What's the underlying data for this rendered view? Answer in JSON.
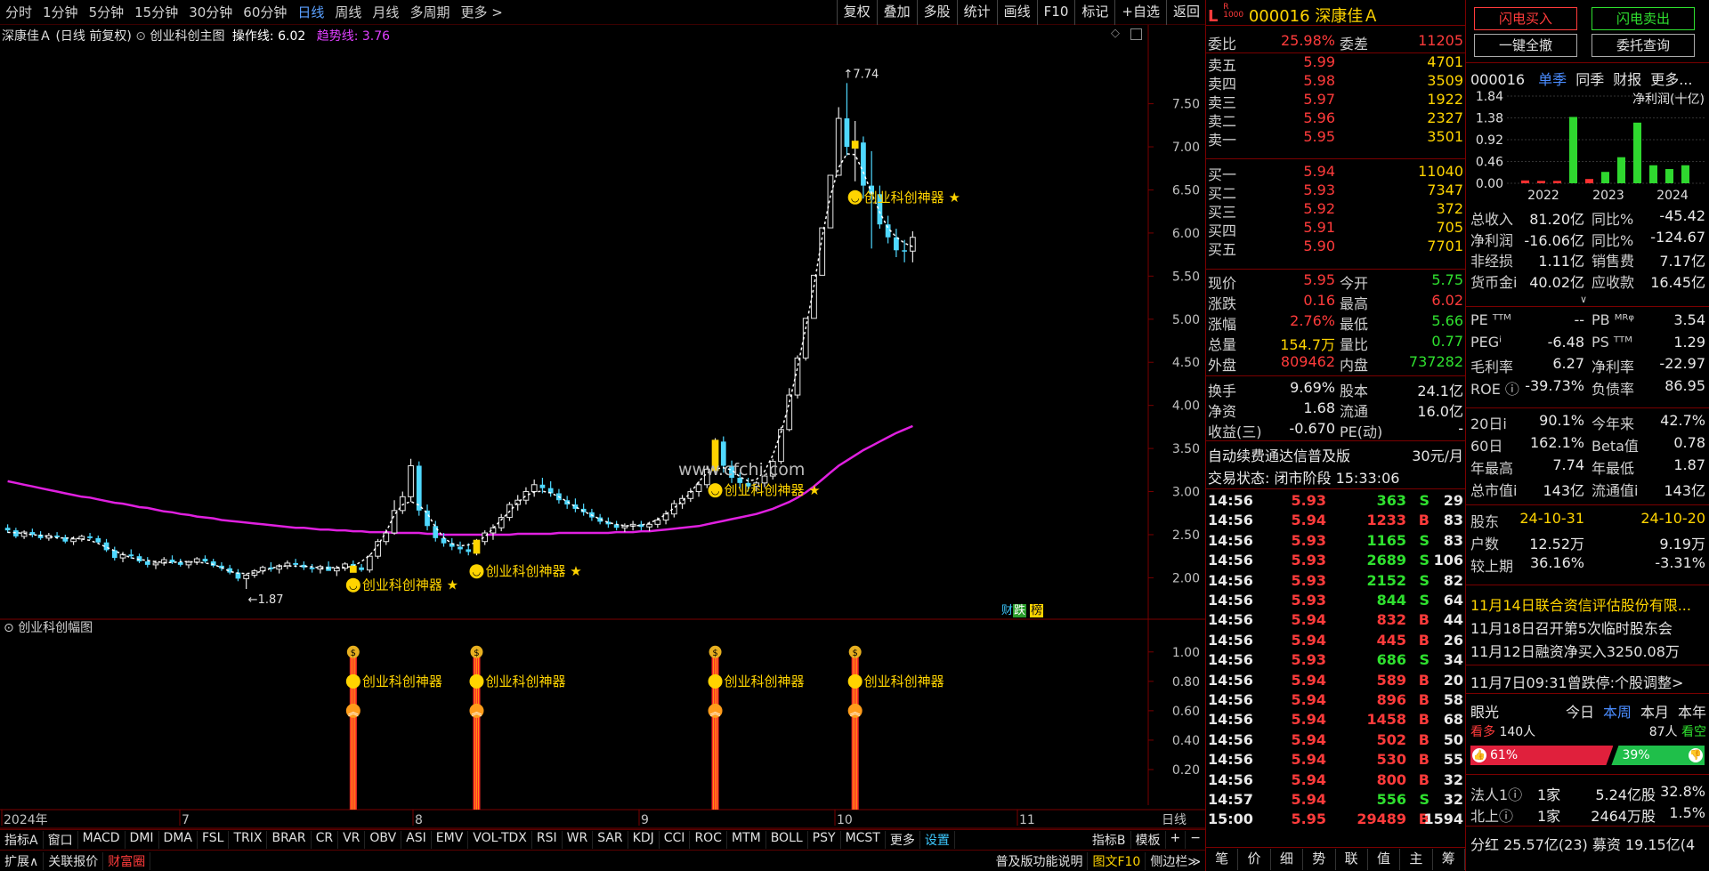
{
  "toolbar": {
    "periods": [
      "分时",
      "1分钟",
      "5分钟",
      "15分钟",
      "30分钟",
      "60分钟",
      "日线",
      "周线",
      "月线",
      "多周期",
      "更多 >"
    ],
    "active_period": "日线",
    "right_buttons": [
      "复权",
      "叠加",
      "多股",
      "统计",
      "画线",
      "F10",
      "标记",
      "+自选",
      "返回"
    ]
  },
  "chart_header": {
    "stock": "深康佳Ａ",
    "mode": "(日线 前复权)",
    "indicator": "创业科创主图",
    "op_line_label": "操作线:",
    "op_line_value": "6.02",
    "trend_line_label": "趋势线:",
    "trend_line_value": "3.76"
  },
  "sub_chart_title": "创业科创幅图",
  "signal_label": "创业科创神器",
  "watermark": "www.cfchi.com",
  "marks": {
    "high": "7.74",
    "low": "1.87"
  },
  "badge": {
    "a": "财",
    "b": "跌",
    "c": "榜"
  },
  "x_axis_labels": [
    "2024年",
    "7",
    "8",
    "9",
    "10",
    "11"
  ],
  "x_axis_right": "日线",
  "chart_data": {
    "type": "candlestick",
    "y_ticks": [
      2.0,
      2.5,
      3.0,
      3.5,
      4.0,
      4.5,
      5.0,
      5.5,
      6.0,
      6.5,
      7.0,
      7.5
    ],
    "ylim": [
      1.55,
      7.95
    ],
    "sub_y_ticks": [
      0.2,
      0.4,
      0.6,
      0.8,
      1.0
    ],
    "sub_ylim": [
      0,
      1.15
    ],
    "ohlc": [
      [
        2.58,
        2.62,
        2.52,
        2.55
      ],
      [
        2.55,
        2.58,
        2.46,
        2.48
      ],
      [
        2.48,
        2.55,
        2.45,
        2.53
      ],
      [
        2.53,
        2.57,
        2.47,
        2.5
      ],
      [
        2.5,
        2.54,
        2.44,
        2.46
      ],
      [
        2.46,
        2.52,
        2.43,
        2.49
      ],
      [
        2.49,
        2.53,
        2.45,
        2.47
      ],
      [
        2.47,
        2.5,
        2.4,
        2.42
      ],
      [
        2.42,
        2.48,
        2.38,
        2.45
      ],
      [
        2.45,
        2.5,
        2.42,
        2.48
      ],
      [
        2.48,
        2.52,
        2.44,
        2.46
      ],
      [
        2.46,
        2.49,
        2.4,
        2.41
      ],
      [
        2.41,
        2.45,
        2.3,
        2.32
      ],
      [
        2.32,
        2.36,
        2.2,
        2.23
      ],
      [
        2.23,
        2.3,
        2.18,
        2.27
      ],
      [
        2.27,
        2.33,
        2.22,
        2.25
      ],
      [
        2.25,
        2.28,
        2.17,
        2.19
      ],
      [
        2.19,
        2.24,
        2.12,
        2.15
      ],
      [
        2.15,
        2.2,
        2.1,
        2.17
      ],
      [
        2.17,
        2.24,
        2.14,
        2.21
      ],
      [
        2.21,
        2.26,
        2.16,
        2.18
      ],
      [
        2.18,
        2.22,
        2.13,
        2.15
      ],
      [
        2.15,
        2.2,
        2.11,
        2.18
      ],
      [
        2.18,
        2.24,
        2.15,
        2.22
      ],
      [
        2.22,
        2.26,
        2.17,
        2.19
      ],
      [
        2.19,
        2.22,
        2.12,
        2.14
      ],
      [
        2.14,
        2.18,
        2.08,
        2.11
      ],
      [
        2.11,
        2.15,
        2.04,
        2.06
      ],
      [
        2.06,
        2.1,
        1.96,
        1.99
      ],
      [
        1.99,
        2.05,
        1.87,
        2.03
      ],
      [
        2.03,
        2.1,
        2.0,
        2.08
      ],
      [
        2.08,
        2.14,
        2.04,
        2.12
      ],
      [
        2.12,
        2.18,
        2.07,
        2.1
      ],
      [
        2.1,
        2.16,
        2.05,
        2.14
      ],
      [
        2.14,
        2.2,
        2.1,
        2.17
      ],
      [
        2.17,
        2.22,
        2.12,
        2.15
      ],
      [
        2.15,
        2.19,
        2.09,
        2.12
      ],
      [
        2.12,
        2.16,
        2.06,
        2.1
      ],
      [
        2.1,
        2.15,
        2.05,
        2.13
      ],
      [
        2.13,
        2.19,
        2.1,
        2.08
      ],
      [
        2.08,
        2.14,
        2.02,
        2.11
      ],
      [
        2.11,
        2.18,
        2.08,
        2.16
      ],
      [
        2.16,
        2.2,
        2.1,
        2.12
      ],
      [
        2.12,
        2.16,
        2.07,
        2.09
      ],
      [
        2.09,
        2.27,
        2.06,
        2.25
      ],
      [
        2.25,
        2.45,
        2.22,
        2.42
      ],
      [
        2.42,
        2.56,
        2.38,
        2.52
      ],
      [
        2.52,
        2.9,
        2.5,
        2.78
      ],
      [
        2.78,
        3.0,
        2.74,
        2.94
      ],
      [
        2.94,
        3.38,
        2.88,
        3.3
      ],
      [
        3.3,
        3.35,
        2.72,
        2.78
      ],
      [
        2.78,
        2.85,
        2.55,
        2.6
      ],
      [
        2.6,
        2.66,
        2.42,
        2.46
      ],
      [
        2.46,
        2.52,
        2.36,
        2.4
      ],
      [
        2.4,
        2.46,
        2.32,
        2.36
      ],
      [
        2.36,
        2.42,
        2.28,
        2.33
      ],
      [
        2.33,
        2.4,
        2.26,
        2.3
      ],
      [
        2.3,
        2.45,
        2.26,
        2.42
      ],
      [
        2.42,
        2.55,
        2.38,
        2.52
      ],
      [
        2.52,
        2.62,
        2.44,
        2.58
      ],
      [
        2.58,
        2.74,
        2.54,
        2.7
      ],
      [
        2.7,
        2.88,
        2.66,
        2.85
      ],
      [
        2.85,
        2.96,
        2.78,
        2.9
      ],
      [
        2.9,
        3.05,
        2.85,
        3.0
      ],
      [
        3.0,
        3.14,
        2.94,
        3.08
      ],
      [
        3.08,
        3.16,
        2.98,
        3.04
      ],
      [
        3.04,
        3.12,
        2.94,
        2.98
      ],
      [
        2.98,
        3.03,
        2.86,
        2.9
      ],
      [
        2.9,
        2.95,
        2.8,
        2.85
      ],
      [
        2.85,
        2.92,
        2.76,
        2.8
      ],
      [
        2.8,
        2.86,
        2.72,
        2.76
      ],
      [
        2.76,
        2.8,
        2.66,
        2.7
      ],
      [
        2.7,
        2.74,
        2.62,
        2.65
      ],
      [
        2.65,
        2.7,
        2.58,
        2.62
      ],
      [
        2.62,
        2.66,
        2.55,
        2.58
      ],
      [
        2.58,
        2.63,
        2.53,
        2.6
      ],
      [
        2.6,
        2.66,
        2.55,
        2.62
      ],
      [
        2.62,
        2.66,
        2.55,
        2.59
      ],
      [
        2.59,
        2.65,
        2.54,
        2.62
      ],
      [
        2.62,
        2.7,
        2.58,
        2.67
      ],
      [
        2.67,
        2.78,
        2.62,
        2.74
      ],
      [
        2.74,
        2.9,
        2.7,
        2.86
      ],
      [
        2.86,
        2.96,
        2.8,
        2.92
      ],
      [
        2.92,
        3.04,
        2.88,
        3.0
      ],
      [
        3.0,
        3.12,
        2.94,
        3.08
      ],
      [
        3.08,
        3.3,
        3.04,
        3.26
      ],
      [
        3.26,
        3.62,
        3.2,
        3.58
      ],
      [
        3.58,
        3.64,
        3.22,
        3.3
      ],
      [
        3.3,
        3.36,
        3.1,
        3.16
      ],
      [
        3.16,
        3.22,
        3.04,
        3.1
      ],
      [
        3.1,
        3.16,
        3.0,
        3.06
      ],
      [
        3.06,
        3.12,
        3.0,
        3.1
      ],
      [
        3.1,
        3.2,
        3.05,
        3.18
      ],
      [
        3.18,
        3.38,
        3.14,
        3.35
      ],
      [
        3.35,
        3.75,
        3.32,
        3.72
      ],
      [
        3.72,
        4.2,
        3.7,
        4.12
      ],
      [
        4.12,
        4.58,
        4.08,
        4.55
      ],
      [
        4.55,
        5.01,
        4.52,
        5.01
      ],
      [
        5.01,
        5.51,
        5.01,
        5.51
      ],
      [
        5.51,
        6.06,
        5.51,
        6.06
      ],
      [
        6.06,
        6.67,
        6.06,
        6.67
      ],
      [
        6.67,
        7.46,
        6.95,
        7.33
      ],
      [
        7.33,
        7.74,
        6.9,
        7.0
      ],
      [
        7.0,
        7.3,
        6.6,
        7.05
      ],
      [
        7.05,
        7.12,
        6.4,
        6.55
      ],
      [
        6.55,
        6.95,
        5.82,
        6.45
      ],
      [
        6.45,
        6.55,
        6.05,
        6.1
      ],
      [
        6.1,
        6.2,
        5.88,
        5.95
      ],
      [
        5.95,
        6.05,
        5.72,
        5.8
      ],
      [
        5.8,
        5.92,
        5.66,
        5.79
      ],
      [
        5.79,
        6.02,
        5.66,
        5.95
      ]
    ],
    "trend_line": [
      3.12,
      3.1,
      3.08,
      3.06,
      3.04,
      3.02,
      3.0,
      2.98,
      2.96,
      2.94,
      2.93,
      2.91,
      2.89,
      2.87,
      2.86,
      2.84,
      2.82,
      2.81,
      2.79,
      2.77,
      2.76,
      2.74,
      2.73,
      2.71,
      2.7,
      2.69,
      2.67,
      2.66,
      2.65,
      2.64,
      2.63,
      2.62,
      2.61,
      2.6,
      2.59,
      2.58,
      2.58,
      2.57,
      2.56,
      2.56,
      2.55,
      2.55,
      2.54,
      2.54,
      2.53,
      2.53,
      2.53,
      2.52,
      2.52,
      2.52,
      2.52,
      2.51,
      2.51,
      2.5,
      2.5,
      2.5,
      2.5,
      2.5,
      2.5,
      2.5,
      2.5,
      2.5,
      2.51,
      2.51,
      2.51,
      2.51,
      2.51,
      2.52,
      2.52,
      2.52,
      2.52,
      2.52,
      2.52,
      2.52,
      2.53,
      2.53,
      2.53,
      2.54,
      2.54,
      2.55,
      2.56,
      2.57,
      2.58,
      2.59,
      2.6,
      2.62,
      2.64,
      2.66,
      2.68,
      2.7,
      2.72,
      2.74,
      2.77,
      2.8,
      2.84,
      2.88,
      2.93,
      2.99,
      3.06,
      3.14,
      3.22,
      3.3,
      3.36,
      3.42,
      3.48,
      3.53,
      3.58,
      3.63,
      3.68,
      3.72,
      3.76
    ],
    "signal_bars": [
      42,
      57,
      86,
      103
    ],
    "sub_levels": {
      "coin": 1.0,
      "face": 0.8,
      "chevron": 0.6
    }
  },
  "quote": {
    "code": "000016",
    "name": "深康佳Ａ",
    "weibi_label": "委比",
    "weibi": "25.98%",
    "weicha_label": "委差",
    "weicha": "11205",
    "asks": [
      {
        "label": "卖五",
        "price": "5.99",
        "vol": "4701"
      },
      {
        "label": "卖四",
        "price": "5.98",
        "vol": "3509"
      },
      {
        "label": "卖三",
        "price": "5.97",
        "vol": "1922"
      },
      {
        "label": "卖二",
        "price": "5.96",
        "vol": "2327"
      },
      {
        "label": "卖一",
        "price": "5.95",
        "vol": "3501"
      }
    ],
    "bids": [
      {
        "label": "买一",
        "price": "5.94",
        "vol": "11040"
      },
      {
        "label": "买二",
        "price": "5.93",
        "vol": "7347"
      },
      {
        "label": "买三",
        "price": "5.92",
        "vol": "372"
      },
      {
        "label": "买四",
        "price": "5.91",
        "vol": "705"
      },
      {
        "label": "买五",
        "price": "5.90",
        "vol": "7701"
      }
    ],
    "stats": [
      {
        "l1": "现价",
        "v1": "5.95",
        "c1": "red",
        "l2": "今开",
        "v2": "5.75",
        "c2": "green"
      },
      {
        "l1": "涨跌",
        "v1": "0.16",
        "c1": "red",
        "l2": "最高",
        "v2": "6.02",
        "c2": "red"
      },
      {
        "l1": "涨幅",
        "v1": "2.76%",
        "c1": "red",
        "l2": "最低",
        "v2": "5.66",
        "c2": "green"
      },
      {
        "l1": "总量",
        "v1": "154.7万",
        "c1": "yellow",
        "l2": "量比",
        "v2": "0.77",
        "c2": "green"
      },
      {
        "l1": "外盘",
        "v1": "809462",
        "c1": "red",
        "l2": "内盘",
        "v2": "737282",
        "c2": "green"
      }
    ],
    "stats2": [
      {
        "l1": "换手",
        "v1": "9.69%",
        "l2": "股本",
        "v2": "24.1亿"
      },
      {
        "l1": "净资",
        "v1": "1.68",
        "l2": "流通",
        "v2": "16.0亿"
      },
      {
        "l1": "收益(三)",
        "v1": "-0.670",
        "l2": "PE(动)",
        "v2": "-"
      }
    ],
    "promo": "自动续费通达信普及版",
    "promo_price": "30元/月",
    "trade_status": "交易状态: 闭市阶段 15:33:06"
  },
  "ticks": [
    {
      "t": "14:56",
      "p": "5.93",
      "v": "363",
      "s": "S",
      "n": "29"
    },
    {
      "t": "14:56",
      "p": "5.94",
      "v": "1233",
      "s": "B",
      "n": "83"
    },
    {
      "t": "14:56",
      "p": "5.93",
      "v": "1165",
      "s": "S",
      "n": "83"
    },
    {
      "t": "14:56",
      "p": "5.93",
      "v": "2689",
      "s": "S",
      "n": "106"
    },
    {
      "t": "14:56",
      "p": "5.93",
      "v": "2152",
      "s": "S",
      "n": "82"
    },
    {
      "t": "14:56",
      "p": "5.93",
      "v": "844",
      "s": "S",
      "n": "64"
    },
    {
      "t": "14:56",
      "p": "5.94",
      "v": "832",
      "s": "B",
      "n": "44"
    },
    {
      "t": "14:56",
      "p": "5.94",
      "v": "445",
      "s": "B",
      "n": "26"
    },
    {
      "t": "14:56",
      "p": "5.93",
      "v": "686",
      "s": "S",
      "n": "34"
    },
    {
      "t": "14:56",
      "p": "5.94",
      "v": "589",
      "s": "B",
      "n": "20"
    },
    {
      "t": "14:56",
      "p": "5.94",
      "v": "896",
      "s": "B",
      "n": "58"
    },
    {
      "t": "14:56",
      "p": "5.94",
      "v": "1458",
      "s": "B",
      "n": "68"
    },
    {
      "t": "14:56",
      "p": "5.94",
      "v": "502",
      "s": "B",
      "n": "50"
    },
    {
      "t": "14:56",
      "p": "5.94",
      "v": "530",
      "s": "B",
      "n": "55"
    },
    {
      "t": "14:56",
      "p": "5.94",
      "v": "800",
      "s": "B",
      "n": "32"
    },
    {
      "t": "14:57",
      "p": "5.94",
      "v": "556",
      "s": "S",
      "n": "32"
    },
    {
      "t": "15:00",
      "p": "5.95",
      "v": "29489",
      "s": "B",
      "n": "1594"
    }
  ],
  "tick_tabs": [
    "笔",
    "价",
    "细",
    "势",
    "联",
    "值",
    "主",
    "筹"
  ],
  "far_right": {
    "btn_buy": "闪电买入",
    "btn_sell": "闪电卖出",
    "btn_cancel": "一键全撤",
    "btn_query": "委托查询",
    "code": "000016",
    "tabs": [
      "单季",
      "同季",
      "财报",
      "更多..."
    ],
    "chart_title": "净利润(十亿)",
    "bar_y_ticks": [
      "1.84",
      "1.38",
      "0.92",
      "0.46",
      "0.00"
    ],
    "bar_years": [
      "2022",
      "2023",
      "2024"
    ],
    "bar_values": [
      {
        "v": 0.06,
        "c": "#ff3030"
      },
      {
        "v": 0.05,
        "c": "#ff3030"
      },
      {
        "v": 0.05,
        "c": "#ff3030"
      },
      {
        "v": 1.4,
        "c": "#2fd82f"
      },
      {
        "v": 0.09,
        "c": "#ff3030"
      },
      {
        "v": 0.24,
        "c": "#2fd82f"
      },
      {
        "v": 0.55,
        "c": "#2fd82f"
      },
      {
        "v": 1.28,
        "c": "#2fd82f"
      },
      {
        "v": 0.38,
        "c": "#2fd82f"
      },
      {
        "v": 0.3,
        "c": "#2fd82f"
      },
      {
        "v": 0.38,
        "c": "#2fd82f"
      }
    ],
    "fin": [
      {
        "l1": "总收入",
        "v1": "81.20亿",
        "l2": "同比%",
        "v2": "-45.42"
      },
      {
        "l1": "净利润",
        "v1": "-16.06亿",
        "l2": "同比%",
        "v2": "-124.67"
      },
      {
        "l1": "非经损",
        "v1": "1.11亿",
        "l2": "销售费",
        "v2": "7.17亿"
      },
      {
        "l1": "货币金i",
        "v1": "40.02亿",
        "l2": "应收款",
        "v2": "16.45亿"
      }
    ],
    "expand": "∨",
    "val": [
      {
        "l1": "PE ᵀᵀᴹ",
        "v1": "--",
        "l2": "PB ᴹᴿᵠ",
        "v2": "3.54"
      },
      {
        "l1": "PEGⁱ",
        "v1": "-6.48",
        "l2": "PS ᵀᵀᴹ",
        "v2": "1.29"
      },
      {
        "l1": "毛利率",
        "v1": "6.27",
        "l2": "净利率",
        "v2": "-22.97"
      },
      {
        "l1": "ROE ⓘ",
        "v1": "-39.73%",
        "l2": "负债率",
        "v2": "86.95"
      }
    ],
    "perf": [
      {
        "l1": "20日i",
        "v1": "90.1%",
        "l2": "今年来",
        "v2": "42.7%"
      },
      {
        "l1": "60日",
        "v1": "162.1%",
        "l2": "Beta值",
        "v2": "0.78"
      },
      {
        "l1": "年最高",
        "v1": "7.74",
        "l2": "年最低",
        "v2": "1.87"
      },
      {
        "l1": "总市值i",
        "v1": "143亿",
        "l2": "流通值i",
        "v2": "143亿"
      }
    ],
    "holders": [
      {
        "l1": "股东",
        "v1": "24-10-31",
        "l2": "",
        "v2": "24-10-20"
      },
      {
        "l1": "户数",
        "v1": "12.52万",
        "l2": "",
        "v2": "9.19万"
      },
      {
        "l1": "较上期",
        "v1": "36.16%",
        "l2": "",
        "v2": "-3.31%"
      }
    ],
    "news": [
      "11月14日联合资信评估股份有限...",
      "11月18日召开第5次临时股东会",
      "11月12日融资净买入3250.08万"
    ],
    "notice": "11月7日09:31曾跌停:个股调整>",
    "vision_title": "眼光",
    "vision_tabs": [
      "今日",
      "本周",
      "本月",
      "本年"
    ],
    "bull_label": "看多",
    "bull_count": "140人",
    "bear_count": "87人",
    "bear_label": "看空",
    "bull_pct": "61%",
    "bear_pct": "39%",
    "inst": [
      {
        "l1": "法人1ⓘ",
        "v1": "1家",
        "v2": "5.24亿股",
        "v3": "32.8%"
      },
      {
        "l1": "北上ⓘ",
        "v1": "1家",
        "v2": "2464万股",
        "v3": "1.5%"
      }
    ],
    "dividend": "分红 25.57亿(23) 募资 19.15亿(4"
  },
  "bottom_tabs": [
    "指标A",
    "窗口",
    "MACD",
    "DMI",
    "DMA",
    "FSL",
    "TRIX",
    "BRAR",
    "CR",
    "VR",
    "OBV",
    "ASI",
    "EMV",
    "VOL-TDX",
    "RSI",
    "WR",
    "SAR",
    "KDJ",
    "CCI",
    "ROC",
    "MTM",
    "BOLL",
    "PSY",
    "MCST",
    "更多",
    "设置"
  ],
  "bottom_right": [
    "指标B",
    "模板",
    "+",
    "−"
  ],
  "bottom2": {
    "expand": "扩展∧",
    "linked": "关联报价",
    "wealth": "财富圈",
    "tip": "普及版功能说明",
    "f10": "图文F10",
    "side": "侧边栏≫"
  }
}
